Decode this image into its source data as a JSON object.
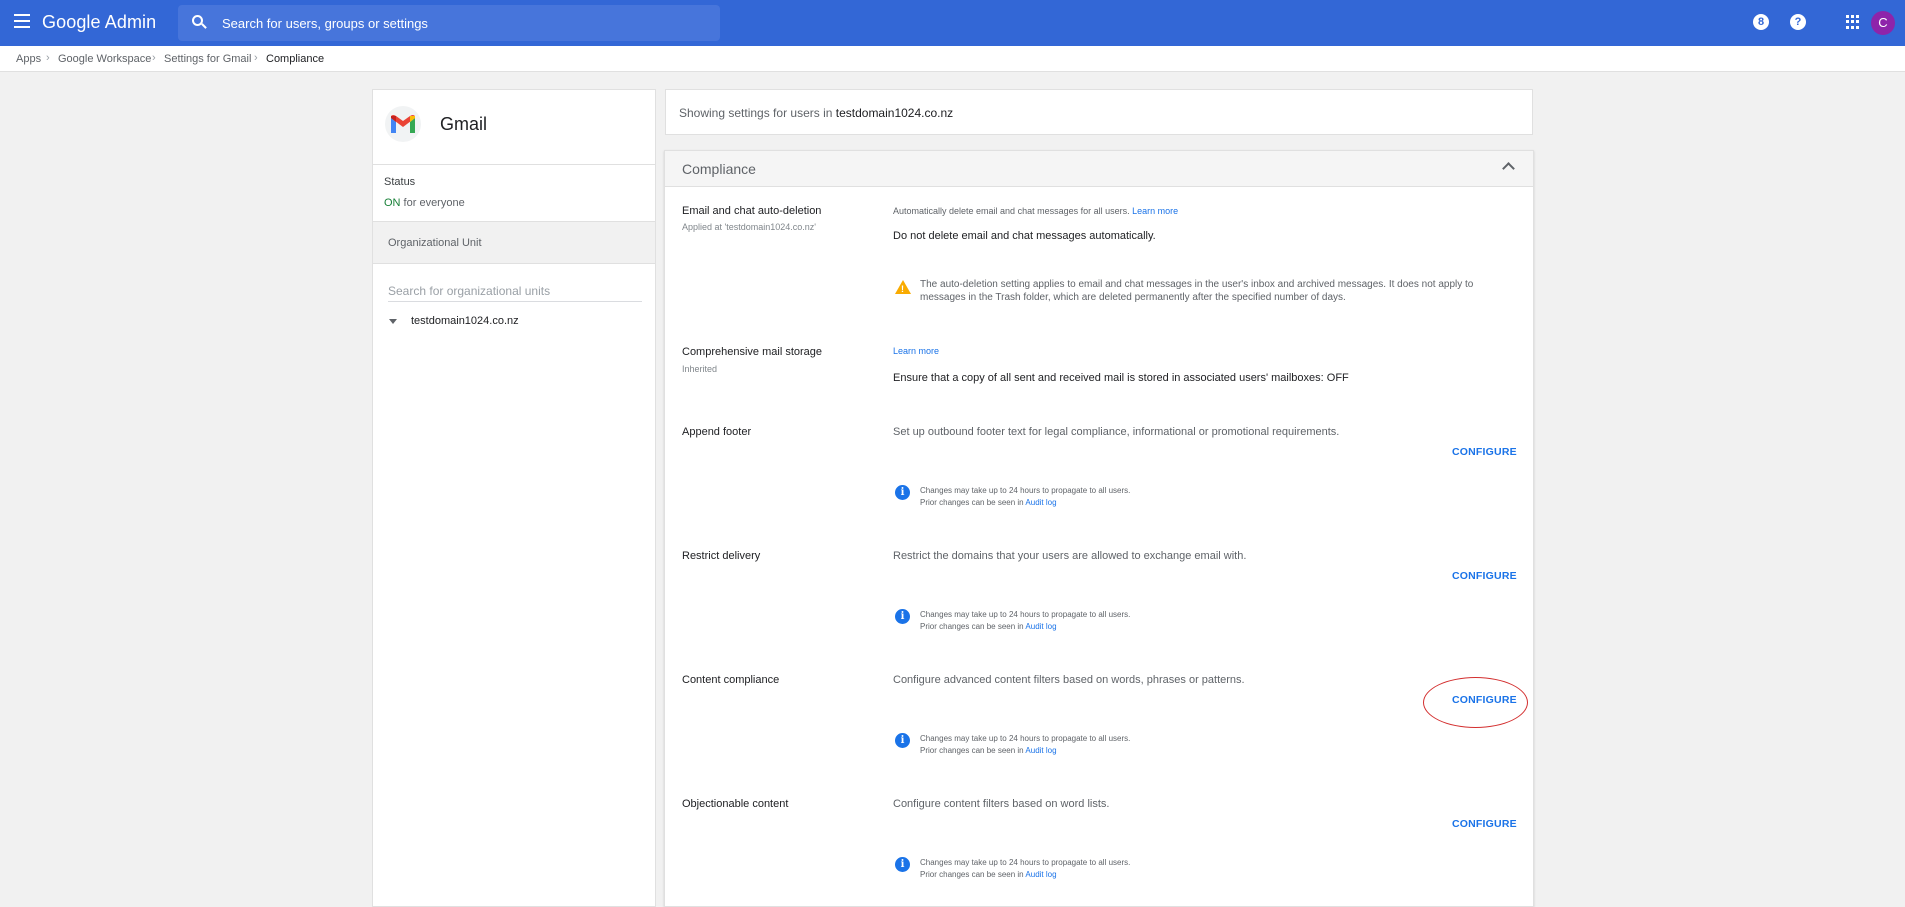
{
  "header": {
    "brand": "Google Admin",
    "search_placeholder": "Search for users, groups or settings",
    "notification_badge": "8",
    "help_label": "?",
    "avatar_initial": "C"
  },
  "breadcrumb": [
    "Apps",
    "Google Workspace",
    "Settings for Gmail",
    "Compliance"
  ],
  "left_panel": {
    "app_name": "Gmail",
    "status_label": "Status",
    "status_on": "ON",
    "status_suffix": " for everyone",
    "ou_header": "Organizational Unit",
    "ou_search_placeholder": "Search for organizational units",
    "ou_root": "testdomain1024.co.nz"
  },
  "main": {
    "showing_prefix": "Showing settings for users in ",
    "showing_domain": "testdomain1024.co.nz",
    "section_title": "Compliance",
    "auto_deletion": {
      "title": "Email and chat auto-deletion",
      "subtitle": "Applied at 'testdomain1024.co.nz'",
      "desc": "Automatically delete email and chat messages for all users.",
      "learn_more": "Learn more",
      "value": "Do not delete email and chat messages automatically.",
      "warning_line1": "The auto-deletion setting applies to email and chat messages in the user's inbox and archived messages. It does not apply to",
      "warning_line2": "messages in the Trash folder, which are deleted permanently after the specified number of days."
    },
    "mail_storage": {
      "title": "Comprehensive mail storage",
      "subtitle": "Inherited",
      "learn_more": "Learn more",
      "value": "Ensure that a copy of all sent and received mail is stored in associated users' mailboxes: OFF"
    },
    "rows": [
      {
        "title": "Append footer",
        "desc": "Set up outbound footer text for legal compliance, informational or promotional requirements.",
        "configure": "CONFIGURE"
      },
      {
        "title": "Restrict delivery",
        "desc": "Restrict the domains that your users are allowed to exchange email with.",
        "configure": "CONFIGURE"
      },
      {
        "title": "Content compliance",
        "desc": "Configure advanced content filters based on words, phrases or patterns.",
        "configure": "CONFIGURE"
      },
      {
        "title": "Objectionable content",
        "desc": "Configure content filters based on word lists.",
        "configure": "CONFIGURE"
      }
    ],
    "info_line1": "Changes may take up to 24 hours to propagate to all users.",
    "info_line2_prefix": "Prior changes can be seen in ",
    "audit_log": "Audit log"
  },
  "colors": {
    "header_bg": "#3367d6",
    "link": "#1a73e8",
    "status_on": "#188038",
    "warning": "#f9ab00",
    "highlight_ellipse": "#d32f2f"
  }
}
